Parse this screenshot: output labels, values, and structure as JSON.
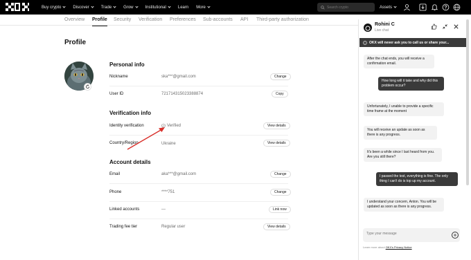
{
  "nav": {
    "logo": "OKX",
    "menu": [
      {
        "label": "Buy crypto",
        "dropdown": true
      },
      {
        "label": "Discover",
        "dropdown": true
      },
      {
        "label": "Trade",
        "dropdown": true
      },
      {
        "label": "Grow",
        "dropdown": true
      },
      {
        "label": "Institutional",
        "dropdown": true
      },
      {
        "label": "Learn",
        "dropdown": false
      },
      {
        "label": "More",
        "dropdown": true
      }
    ],
    "search_placeholder": "Search crypto",
    "assets_label": "Assets",
    "icons": [
      "user-icon",
      "download-icon",
      "bell-icon",
      "help-icon",
      "globe-icon"
    ]
  },
  "subnav": {
    "tabs": [
      "Overview",
      "Profile",
      "Security",
      "Verification",
      "Preferences",
      "Sub-accounts",
      "API",
      "Third-party authorization"
    ],
    "active": "Profile"
  },
  "profile": {
    "title": "Profile",
    "personal_info": {
      "title": "Personal info",
      "nickname_label": "Nickname",
      "nickname_value": "ska***@gmail.com",
      "nickname_btn": "Change",
      "userid_label": "User ID",
      "userid_value": "721714315023388874",
      "userid_btn": "Copy"
    },
    "verification_info": {
      "title": "Verification info",
      "identity_label": "Identity verification",
      "identity_value": "Verified",
      "identity_btn": "View details",
      "country_label": "Country/Region",
      "country_value": "Ukraine",
      "country_btn": "View details"
    },
    "account_details": {
      "title": "Account details",
      "email_label": "Email",
      "email_value": "aka***@gmail.com",
      "email_btn": "Change",
      "phone_label": "Phone",
      "phone_value": "****751",
      "phone_btn": "Change",
      "linked_label": "Linked accounts",
      "linked_value": "—",
      "linked_btn": "Link now",
      "tier_label": "Trading fee tier",
      "tier_value": "Regular user",
      "tier_btn": "View details"
    }
  },
  "chat": {
    "agent_name": "Rohini C",
    "status": "Live chat",
    "warning": "OKX will never ask you to call us or share your...",
    "messages": [
      {
        "from": "agent",
        "text": "After the chat ends, you will receive a confirmation email."
      },
      {
        "from": "user",
        "text": "How long will it take and why did this problem occur?"
      },
      {
        "from": "agent",
        "text": "Unfortunately, I unable to provide a specific time frame at the moment"
      },
      {
        "from": "agent",
        "text": "You will receive an update as soon as there is any progress."
      },
      {
        "from": "agent",
        "text": "It's been a while since I last heard from you. Are you still there?"
      },
      {
        "from": "user",
        "text": "I passed the test, everything is fine. The only thing I can't do is top up my account."
      },
      {
        "from": "agent",
        "text": "I understand your concern, Anton. You will be updated as soon as there is any progress."
      }
    ],
    "input_placeholder": "Type your message",
    "privacy_prefix": "Learn more about ",
    "privacy_link": "OKX's Privacy Notice"
  }
}
